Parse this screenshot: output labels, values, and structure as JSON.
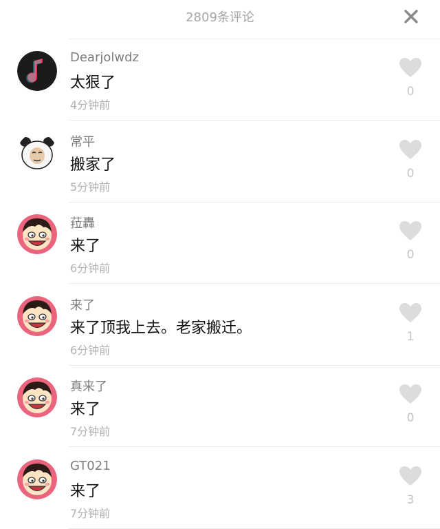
{
  "header": {
    "title": "2809条评论",
    "close_icon": "close-icon"
  },
  "colors": {
    "music_logo_bg": "#1b1b1b",
    "music_note_pink": "#ff2d55",
    "text_primary": "#111111",
    "text_secondary": "#7c7c7c",
    "text_muted": "#b0b0b0",
    "heart_gray": "#dcdcdc"
  },
  "comments": [
    {
      "user": "Dearjolwdz",
      "text": "太狠了",
      "time": "4分钟前",
      "likes": "0",
      "avatar": "music-note-avatar"
    },
    {
      "user": "常平",
      "text": "搬家了",
      "time": "5分钟前",
      "likes": "0",
      "avatar": "panda-meme-avatar"
    },
    {
      "user": "菈轟",
      "text": "来了",
      "time": "6分钟前",
      "likes": "0",
      "avatar": "cartoon-boy-avatar"
    },
    {
      "user": "来了",
      "text": "来了顶我上去。老家搬迁。",
      "time": "6分钟前",
      "likes": "1",
      "avatar": "cartoon-boy-avatar"
    },
    {
      "user": "真来了",
      "text": "来了",
      "time": "7分钟前",
      "likes": "0",
      "avatar": "cartoon-boy-avatar"
    },
    {
      "user": "GT021",
      "text": "来了",
      "time": "7分钟前",
      "likes": "3",
      "avatar": "cartoon-boy-avatar"
    }
  ]
}
